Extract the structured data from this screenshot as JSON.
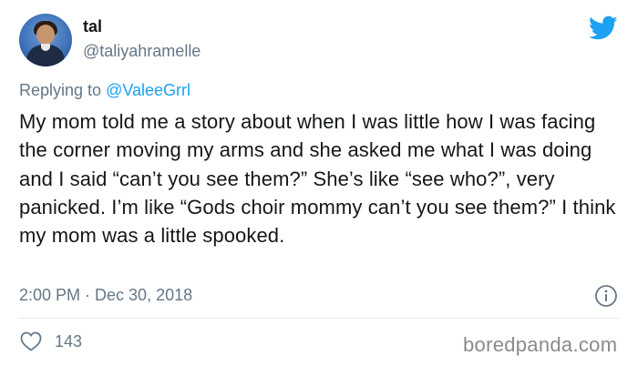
{
  "author": {
    "display_name": "tal",
    "handle": "@taliyahramelle",
    "avatar": "profile-photo"
  },
  "reply": {
    "prefix": "Replying to ",
    "mention": "@ValeeGrrl"
  },
  "tweet": {
    "text": "My mom told me a story about when I was little how I was facing the corner moving my arms and she asked me what I was doing and I said “can’t you see them?” She’s like “see who?”, very panicked. I’m like “Gods choir mommy can’t you see them?” I think my mom was a little spooked.",
    "timestamp": "2:00 PM · Dec 30, 2018"
  },
  "engagement": {
    "likes": "143"
  },
  "watermark": "boredpanda.com",
  "icons": {
    "brand": "twitter-bird-icon",
    "info": "info-icon",
    "like": "heart-icon"
  },
  "colors": {
    "brand_blue": "#1da1f2",
    "secondary_text": "#657786",
    "primary_text": "#14171a",
    "divider": "#e1e8ed"
  }
}
